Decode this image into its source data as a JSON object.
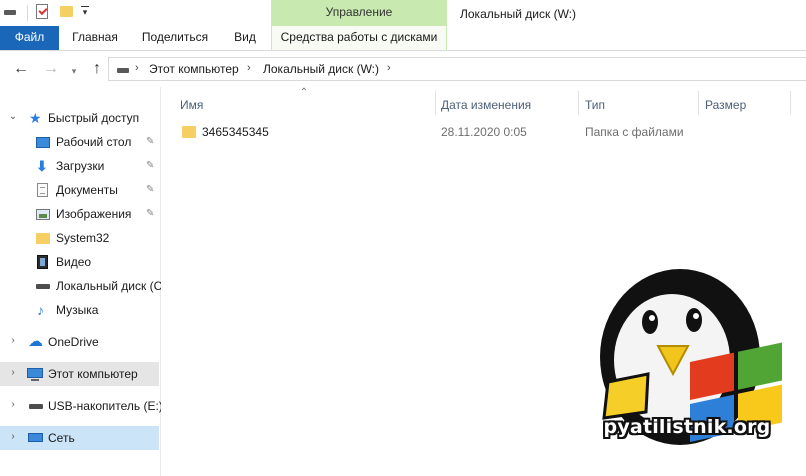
{
  "window": {
    "title": "Локальный диск (W:)"
  },
  "quick_access_toolbar": {
    "icons": [
      "drive-icon",
      "properties-icon",
      "new-folder-icon",
      "customize-dropdown-icon"
    ]
  },
  "ribbon": {
    "context_group_label": "Управление",
    "tabs": [
      {
        "label": "Файл"
      },
      {
        "label": "Главная"
      },
      {
        "label": "Поделиться"
      },
      {
        "label": "Вид"
      },
      {
        "label": "Средства работы с дисками"
      }
    ],
    "colors": {
      "file_tab": "#1a66b8",
      "context_tab": "#c8eab0"
    }
  },
  "address_bar": {
    "breadcrumbs": [
      "Этот компьютер",
      "Локальный диск (W:)"
    ],
    "separator": "›"
  },
  "nav_pane": {
    "items": [
      {
        "label": "Быстрый доступ",
        "icon": "star-icon",
        "expanded": true
      },
      {
        "label": "Рабочий стол",
        "icon": "desktop-icon",
        "pinned": true
      },
      {
        "label": "Загрузки",
        "icon": "download-icon",
        "pinned": true
      },
      {
        "label": "Документы",
        "icon": "documents-icon",
        "pinned": true
      },
      {
        "label": "Изображения",
        "icon": "pictures-icon",
        "pinned": true
      },
      {
        "label": "System32",
        "icon": "folder-icon"
      },
      {
        "label": "Видео",
        "icon": "video-icon"
      },
      {
        "label": "Локальный диск (C",
        "icon": "drive-icon"
      },
      {
        "label": "Музыка",
        "icon": "music-icon"
      },
      {
        "label": "OneDrive",
        "icon": "cloud-icon"
      },
      {
        "label": "Этот компьютер",
        "icon": "computer-icon"
      },
      {
        "label": "USB-накопитель (E:)",
        "icon": "usb-drive-icon"
      },
      {
        "label": "Сеть",
        "icon": "network-icon"
      }
    ]
  },
  "file_list": {
    "columns": [
      "Имя",
      "Дата изменения",
      "Тип",
      "Размер"
    ],
    "rows": [
      {
        "name": "3465345345",
        "date": "28.11.2020 0:05",
        "type": "Папка с файлами",
        "size": ""
      }
    ]
  },
  "watermark": {
    "text": "pyatilistnik.org"
  }
}
